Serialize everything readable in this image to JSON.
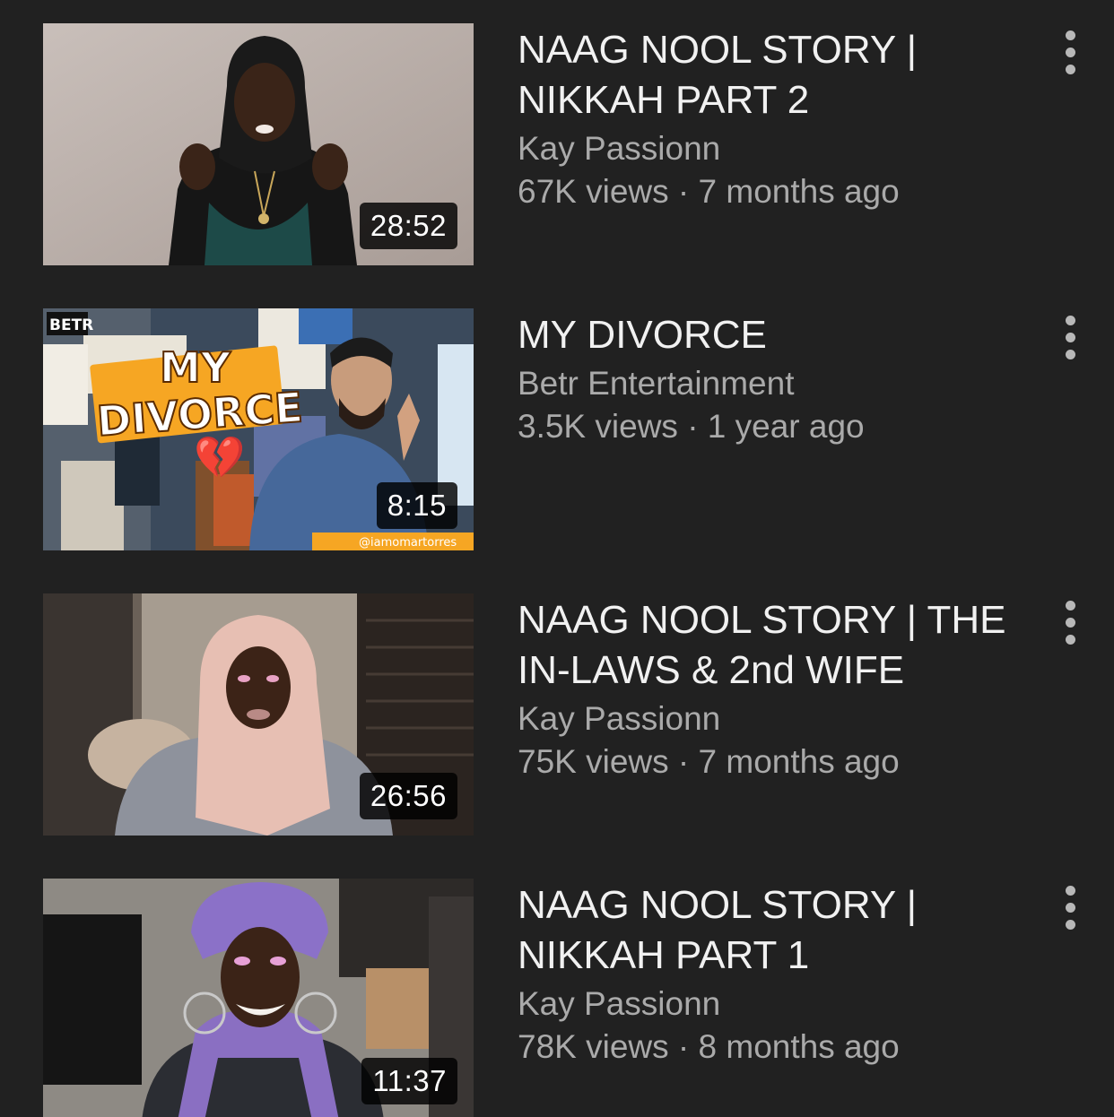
{
  "videos": [
    {
      "title": "NAAG NOOL STORY | NIKKAH PART 2",
      "channel": "Kay Passionn",
      "stats": "67K views · 7 months ago",
      "duration": "28:52"
    },
    {
      "title": "MY DIVORCE",
      "channel": "Betr Entertainment",
      "stats": "3.5K views · 1 year ago",
      "duration": "8:15",
      "thumbnail_text": {
        "logo": "BETR",
        "headline_1": "MY",
        "headline_2": "DIVORCE",
        "heart": "💔",
        "handle": "@iamomartorres"
      }
    },
    {
      "title": "NAAG NOOL STORY | THE IN-LAWS & 2nd WIFE",
      "channel": "Kay Passionn",
      "stats": "75K views · 7 months ago",
      "duration": "26:56"
    },
    {
      "title": "NAAG NOOL STORY | NIKKAH PART 1",
      "channel": "Kay Passionn",
      "stats": "78K views · 8 months ago",
      "duration": "11:37"
    }
  ],
  "icons": {
    "menu": "more-vert-icon"
  },
  "colors": {
    "background": "#212121",
    "title": "#f1f1f1",
    "secondary": "#aaaaaa",
    "divorce_headline_bg": "#f6a623"
  }
}
